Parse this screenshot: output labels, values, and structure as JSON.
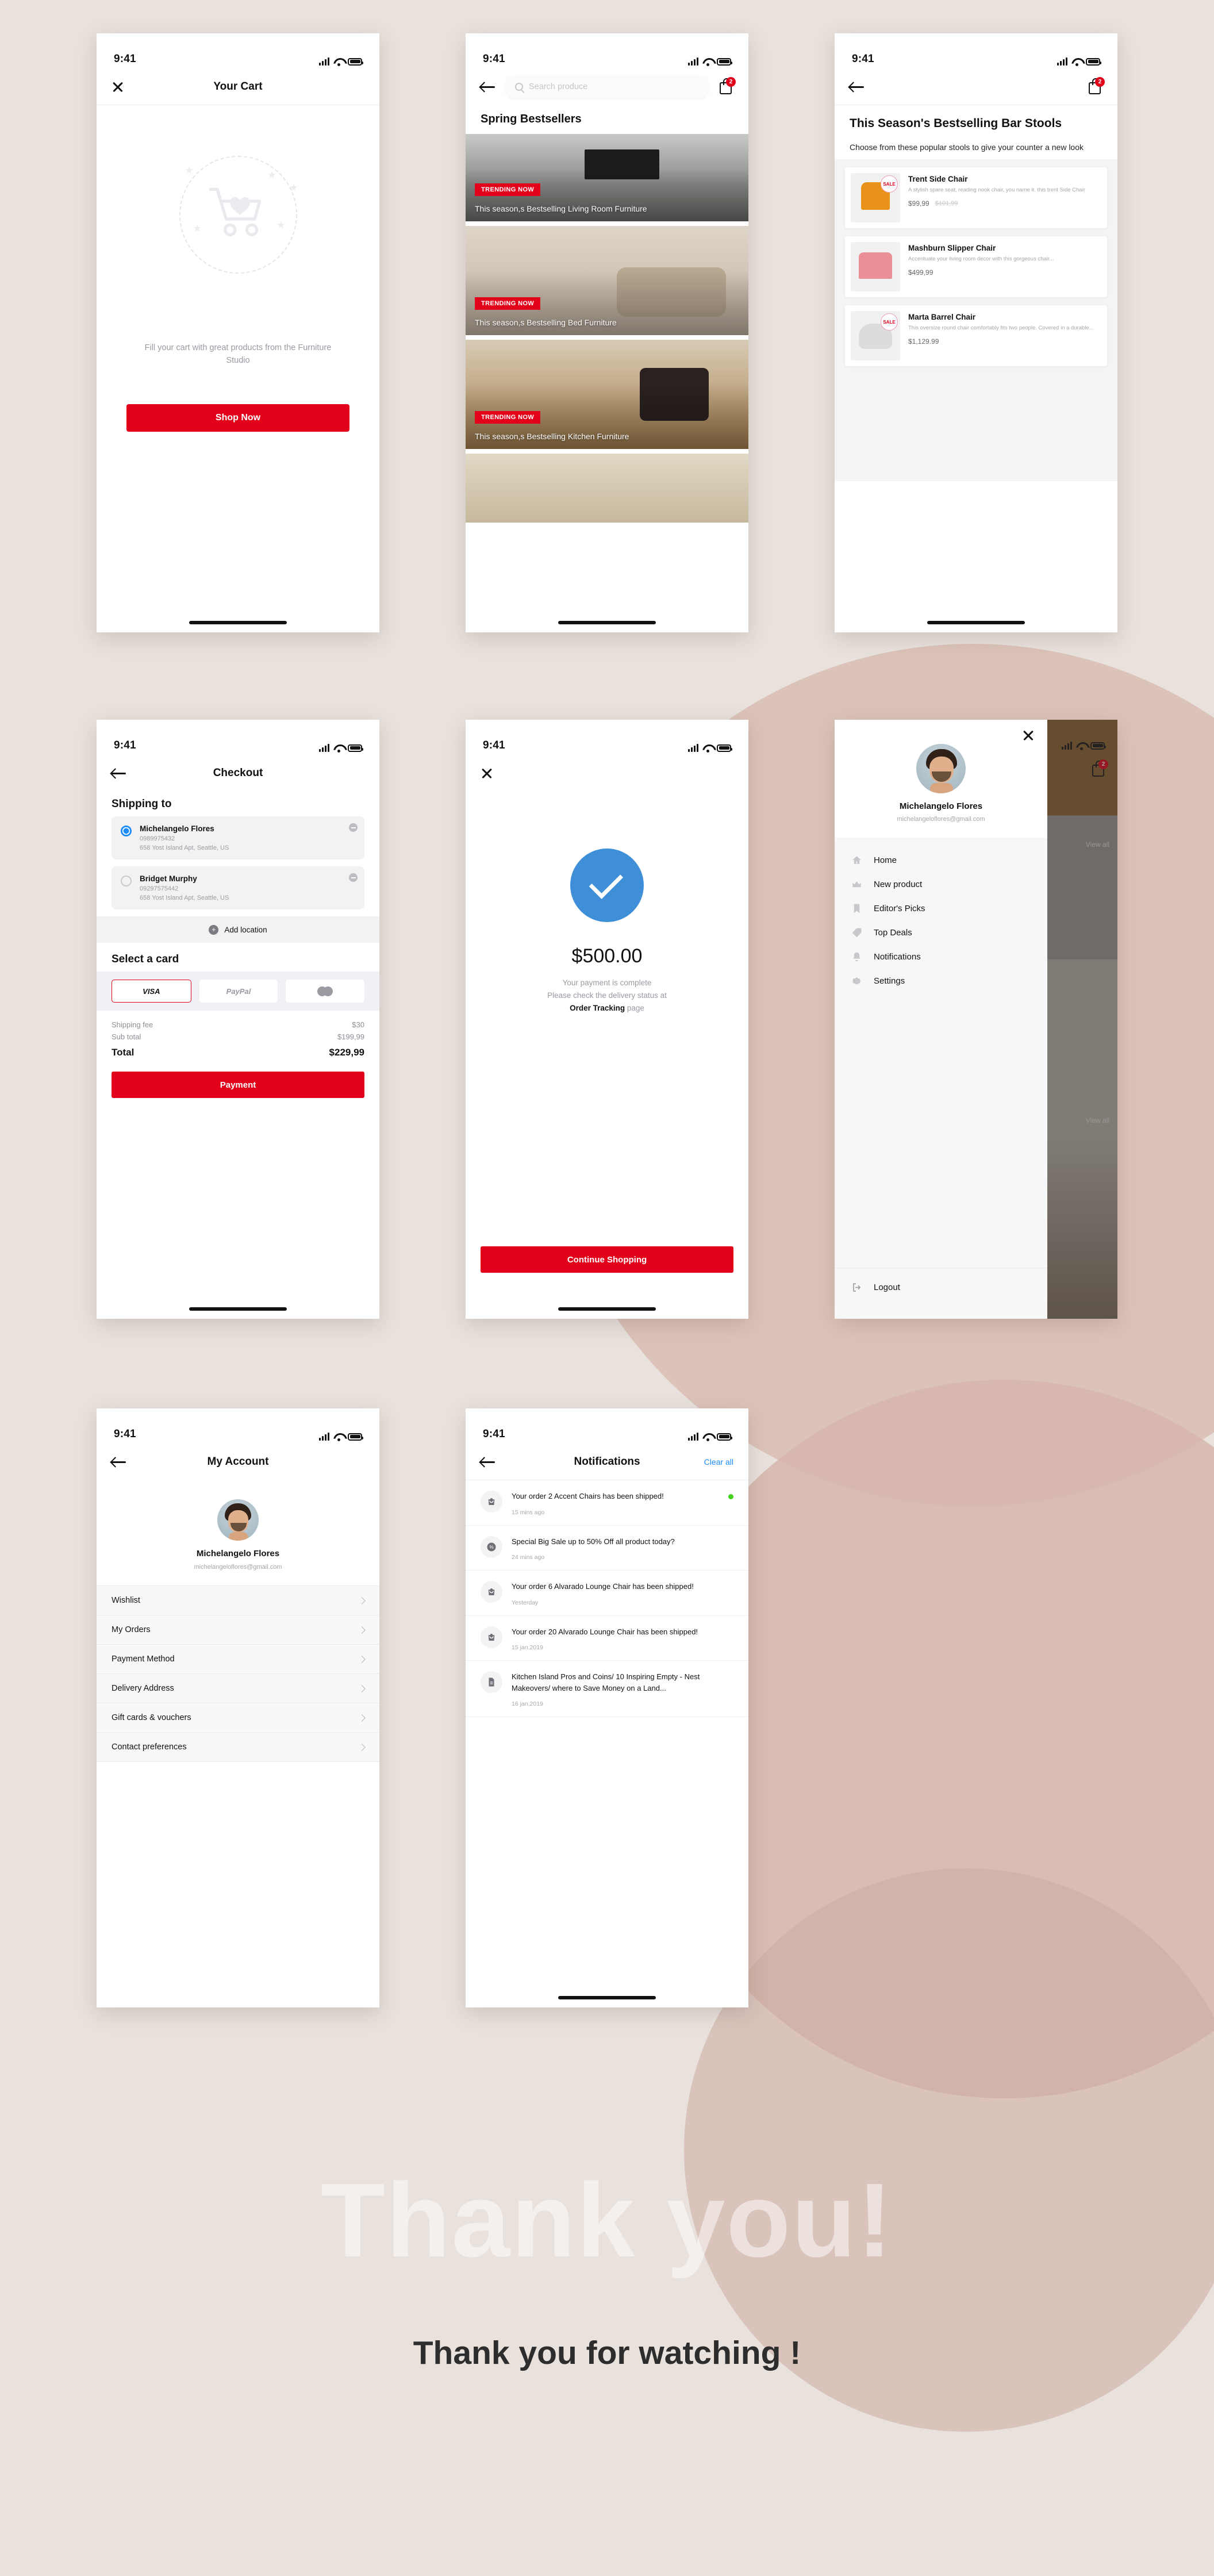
{
  "status_bar": {
    "time": "9:41"
  },
  "screens": {
    "cart": {
      "title": "Your Cart",
      "empty_text": "Fill your cart with great products from the Furniture Studio",
      "cta": "Shop Now"
    },
    "bestsellers": {
      "search_placeholder": "Search produce",
      "cart_badge": "2",
      "section_title": "Spring Bestsellers",
      "promos": [
        {
          "tag": "TRENDING NOW",
          "caption": "This season,s Bestselling Living Room Furniture"
        },
        {
          "tag": "TRENDING NOW",
          "caption": "This season,s Bestselling Bed Furniture"
        },
        {
          "tag": "TRENDING NOW",
          "caption": "This season,s Bestselling Kitchen Furniture"
        }
      ]
    },
    "bar_stools": {
      "cart_badge": "2",
      "title": "This Season's Bestselling Bar Stools",
      "subtitle": "Choose from these popular stools to give your counter a new look",
      "products": [
        {
          "name": "Trent Side Chair",
          "desc": "A stylish spare seat, reading nook chair, you name it. this trent Side Chair",
          "price": "$99,99",
          "old_price": "$101,99",
          "sale_badge": "SALE"
        },
        {
          "name": "Mashburn Slipper Chair",
          "desc": "Accentuate your living room decor with this gorgeous chair...",
          "price": "$499,99",
          "old_price": "",
          "sale_badge": ""
        },
        {
          "name": "Marta Barrel Chair",
          "desc": "This oversize round chair comfortably fits two people. Covered in a durable...",
          "price": "$1,129.99",
          "old_price": "",
          "sale_badge": "SALE"
        }
      ]
    },
    "checkout": {
      "title": "Checkout",
      "shipping_heading": "Shipping to",
      "addresses": [
        {
          "name": "Michelangelo Flores",
          "phone": "0989975432",
          "line": "658 Yost Island Apt, Seattle, US",
          "selected": true
        },
        {
          "name": "Bridget Murphy",
          "phone": "09297575442",
          "line": "658 Yost Island Apt, Seattle, US",
          "selected": false
        }
      ],
      "add_location": "Add location",
      "card_heading": "Select a card",
      "cards": [
        {
          "label": "VISA",
          "selected": true
        },
        {
          "label": "PayPal",
          "selected": false
        },
        {
          "label": "mastercard-icon",
          "selected": false
        }
      ],
      "summary": [
        {
          "label": "Shipping fee",
          "value": "$30"
        },
        {
          "label": "Sub total",
          "value": "$199,99"
        }
      ],
      "total_label": "Total",
      "total_value": "$229,99",
      "pay_button": "Payment"
    },
    "success": {
      "amount": "$500.00",
      "line1": "Your payment is complete",
      "line2": "Please check the delivery status at",
      "link": "Order Tracking",
      "line3": "page",
      "cta": "Continue Shopping"
    },
    "drawer": {
      "user_name": "Michelangelo Flores",
      "user_email": "michelangeloflores@gmail.com",
      "cart_badge": "2",
      "bg_label": "View all",
      "items": [
        {
          "label": "Home",
          "icon": "home-icon"
        },
        {
          "label": "New product",
          "icon": "crown-icon"
        },
        {
          "label": "Editor's Picks",
          "icon": "bookmark-icon"
        },
        {
          "label": "Top Deals",
          "icon": "tag-icon"
        },
        {
          "label": "Notifications",
          "icon": "bell-icon"
        },
        {
          "label": "Settings",
          "icon": "gear-icon"
        }
      ],
      "logout": "Logout"
    },
    "account": {
      "title": "My Account",
      "user_name": "Michelangelo Flores",
      "user_email": "michelangeloflores@gmail.com",
      "items": [
        {
          "label": "Wishlist"
        },
        {
          "label": "My Orders"
        },
        {
          "label": "Payment Method"
        },
        {
          "label": "Delivery Address"
        },
        {
          "label": "Gift cards & vouchers"
        },
        {
          "label": "Contact preferences"
        }
      ]
    },
    "notifications": {
      "title": "Notifications",
      "clear_all": "Clear all",
      "items": [
        {
          "text": "Your order 2 Accent Chairs has been shipped!",
          "time": "15 mins ago",
          "icon": "bag-icon",
          "unread": true
        },
        {
          "text": "Special Big Sale up to 50% Off all product today?",
          "time": "24 mins ago",
          "icon": "percent-icon",
          "unread": false
        },
        {
          "text": "Your order 6 Alvarado Lounge Chair has been shipped!",
          "time": "Yesterday",
          "icon": "bag-icon",
          "unread": false
        },
        {
          "text": "Your order 20 Alvarado Lounge Chair has been shipped!",
          "time": "15 jan,2019",
          "icon": "bag-icon",
          "unread": false
        },
        {
          "text": "Kitchen Island Pros and Coins/ 10 Inspiring Empty - Nest Makeovers/ where to Save Money on a Land...",
          "time": "16 jan,2019",
          "icon": "document-icon",
          "unread": false
        }
      ]
    }
  },
  "footer": {
    "ghost_text": "Thank you!",
    "thanks_text": "Thank you for watching !"
  },
  "colors": {
    "accent": "#e3001b",
    "link": "#1d8cf8",
    "bg": "#e8e1dc"
  }
}
